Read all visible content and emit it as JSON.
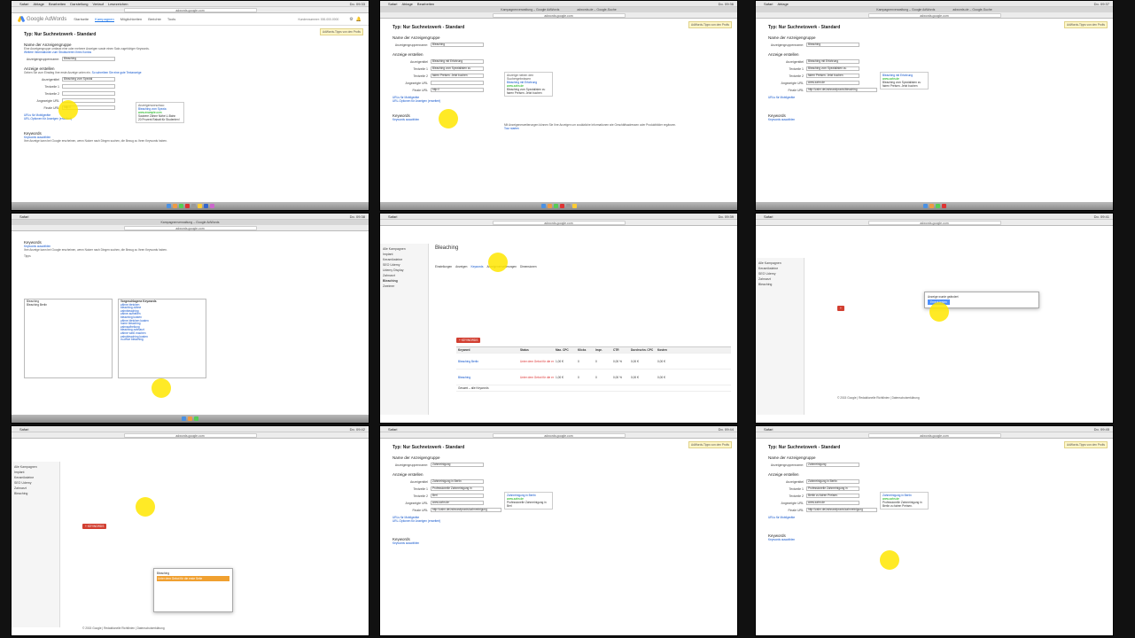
{
  "browser": {
    "menu_items": [
      "Safari",
      "Ablage",
      "Bearbeiten",
      "Darstellung",
      "Verlauf",
      "Lesezeichen",
      "Entwickler",
      "Fenster",
      "Hilfe"
    ],
    "url": "adwords.google.com",
    "tab1": "Kampagnenverwaltung – Google AdWords",
    "tab2": "adwords.de – Google-Suche",
    "panel_times": [
      "Do. 09:33",
      "Do. 09:36",
      "Do. 09:37",
      "Do. 09:38",
      "Do. 09:39",
      "Do. 09:41",
      "Do. 09:42",
      "Do. 09:44",
      "Do. 09:45"
    ]
  },
  "adwords": {
    "logo_text": "Google AdWords",
    "nav": [
      "Startseite",
      "Kampagnen",
      "Möglichkeiten",
      "Berichte",
      "Tools"
    ],
    "account": "Kundennummer: 000-000-0000",
    "icons": [
      "gear-icon",
      "bell-icon",
      "help-icon"
    ]
  },
  "form": {
    "type_label": "Typ:",
    "type_value": "Nur Suchnetzwerk - Standard",
    "badge_text": "AdWords-Tipps von den Profis",
    "section_adgroup": "Name der Anzeigengruppe",
    "adgroup_desc": "Eine Anzeigengruppe umfasst eine oder mehrere Anzeigen sowie einen Satz zugehöriger Keywords.",
    "adgroup_link": "Weitere Informationen zum Strukturieren Ihres Kontos",
    "adgroup_label": "Anzeigengruppenname:",
    "section_ad": "Anzeige erstellen",
    "ad_desc": "Geben Sie zum Einstieg Ihre erste Anzeige unten ein.",
    "ad_link": "So schreiben Sie eine gute Textanzeige",
    "labels": {
      "headline": "Anzeigentitel",
      "line1": "Textzeile 1",
      "line2": "Textzeile 2",
      "display_url": "Angezeigte URL",
      "final_url": "Finale URL"
    },
    "final_url_prefix": "http://",
    "mobile_link": "URLs für Mobilgeräte",
    "url_options_link": "URL-Optionen für Anzeigen (erweitert)",
    "preview_title": "Anzeigenvorschau:",
    "preview_side": "Anzeige neben den Suchergebnissen",
    "extensions": "Mit Anzeigenerweiterungen können Sie Ihre Anzeigen um zusätzliche Informationen wie Geschäftsadressen oder Produktbilder ergänzen.",
    "extensions_link": "Tour starten",
    "keywords_heading": "Keywords",
    "keywords_link": "Keywords auswählen",
    "keywords_desc": "Ihre Anzeige kann bei Google erscheinen, wenn Nutzer nach Dingen suchen, die Bezug zu Ihren Keywords haben.",
    "keywords_tips": "Tipps"
  },
  "panels": [
    {
      "id": "p1",
      "adgroup_value": "Bleaching",
      "headline": "Bleaching vom Spezial",
      "line1": "",
      "line2": "",
      "display_url": "",
      "final_url": "",
      "preview_title_text": "Bleaching vom Spezia",
      "preview_url": "www.example.com",
      "preview_l1": "Saubere Zähne Nähe U-Bahn",
      "preview_l2": "20 Prozent Rabatt für Studenten!"
    },
    {
      "id": "p2",
      "adgroup_value": "Bleaching",
      "headline": "Bleaching mit Erfahrung",
      "line1": "Bleaching vom Spezialisten zu",
      "line2": "fairen Preisen. Jetzt buchen",
      "display_url": "",
      "final_url": "",
      "preview_title_text": "Bleaching mit Erfahrung",
      "preview_url": "www.zahn.de",
      "preview_l1": "Bleaching vom Spezialisten zu",
      "preview_l2": "fairen Preisen. Jetzt buchen"
    },
    {
      "id": "p3",
      "adgroup_value": "Bleaching",
      "headline": "Bleaching mit Erfahrung",
      "line1": "Bleaching vom Spezialisten zu",
      "line2": "fairen Preisen. Jetzt buchen",
      "display_url": "www.zahn.de",
      "final_url": "zahn.de/zahnarztpraxis/bleaching",
      "preview_title_text": "Bleaching mit Erfahrung",
      "preview_url": "www.zahn.de",
      "preview_l1": "Bleaching vom Spezialisten zu",
      "preview_l2": "fairen Preisen. Jetzt buchen"
    },
    {
      "id": "p8",
      "adgroup_value": "Zahnreinigung",
      "headline": "Zahnreinigung in Berlin",
      "line1": "Professionelle Zahnreinigung in",
      "line2": "Berl",
      "display_url": "www.zahn.de",
      "final_url": "zahn.de/zahnarztpraxis/zahnreinigung",
      "preview_title_text": "Zahnreinigung in Berlin",
      "preview_url": "www.zahn.de",
      "preview_l1": "Professionelle Zahnreinigung in",
      "preview_l2": "Berl"
    },
    {
      "id": "p9",
      "adgroup_value": "Zahnreinigung",
      "headline": "Zahnreinigung in Berlin",
      "line1": "Professionelle Zahnreinigung in",
      "line2": "Berlin zu fairen Preisen.",
      "display_url": "www.zahn.de",
      "final_url": "zahn.de/zahnarztpraxis/zahnreinigung",
      "preview_title_text": "Zahnreinigung in Berlin",
      "preview_url": "www.zahn.de",
      "preview_l1": "Professionelle Zahnreinigung in",
      "preview_l2": "Berlin zu fairen Preisen."
    }
  ],
  "keywords_panel": {
    "entered": [
      "Bleaching",
      "Bleaching Berlin"
    ],
    "suggested_title": "Vorgeschlagene Keywords",
    "suggested": [
      "+ Hinzufügen",
      "zähne bleichen",
      "bleaching zähne",
      "zahnbleaching",
      "zähne aufhellen",
      "bleaching kosten",
      "zähne bleichen kosten",
      "home bleaching",
      "zahnaufhellung",
      "bleaching zahnarzt",
      "zähne weiß machen",
      "zahnbleaching kosten",
      "in-office bleaching"
    ]
  },
  "campaign": {
    "name": "Bleaching",
    "left_nav": [
      "Alle Kampagnen",
      "Implant",
      "Keramiksteine",
      "SEO Udemy",
      "Udemy Display",
      "Zahnarzt",
      "Bleaching",
      "Zweimer"
    ],
    "tabs": [
      "Anzeigengruppen",
      "Einstellungen",
      "Anzeigen",
      "Keywords",
      "Anzeigenerweiterungen",
      "Dimensionen"
    ],
    "keywords_btn": "+ KEYWORDS",
    "columns": [
      "Keyword",
      "Status",
      "Max. CPC",
      "Klicks",
      "Impr.",
      "CTR",
      "Durchschn. CPC",
      "Kosten"
    ],
    "rows": [
      {
        "kw": "Bleaching Berlin",
        "status": "Unter dem Gebot für die erste Seite",
        "cpc": "1,00 €",
        "clicks": "0",
        "impr": "0",
        "ctr": "0,00 %",
        "avg": "0,00 €",
        "cost": "0,00 €"
      },
      {
        "kw": "Bleaching",
        "status": "Unter dem Gebot für die erste Seite",
        "cpc": "1,00 €",
        "clicks": "0",
        "impr": "0",
        "ctr": "0,00 %",
        "avg": "0,00 €",
        "cost": "0,00 €"
      }
    ],
    "total_label": "Gesamt – alle Keywords",
    "popup_title": "Anzeige wurde geändert",
    "popup_btn": "Erneut testen",
    "footer": "© 2015 Google | Redaktionelle Richtlinien | Datenschutzerklärung"
  }
}
